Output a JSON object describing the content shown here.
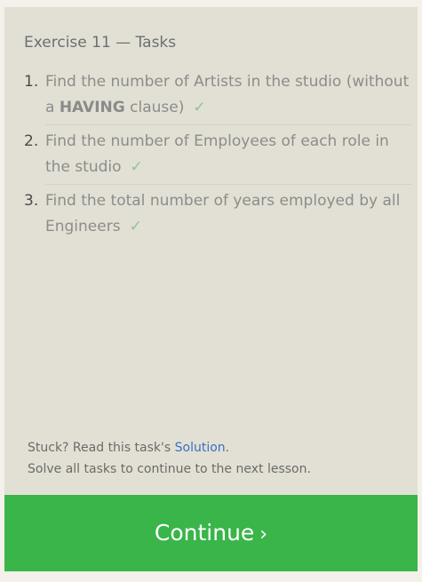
{
  "panel": {
    "title": "Exercise 11 — Tasks"
  },
  "tasks": [
    {
      "number": "1.",
      "text_before": "Find the number of Artists in the studio (without a ",
      "strong": "HAVING",
      "text_after": " clause)",
      "check": "✓"
    },
    {
      "number": "2.",
      "text_before": "Find the number of Employees of each role in the studio",
      "check": "✓"
    },
    {
      "number": "3.",
      "text_before": "Find the total number of years employed by all Engineers",
      "check": "✓"
    }
  ],
  "footer": {
    "stuck_prefix": "Stuck? Read this task's ",
    "solution_link": "Solution",
    "stuck_suffix": ".",
    "instruction": "Solve all tasks to continue to the next lesson."
  },
  "continue_button": {
    "label": "Continue",
    "chevron": "›"
  },
  "colors": {
    "panel_bg": "#e2e0d4",
    "button_bg": "#39b54a",
    "check": "#8fc493",
    "link": "#3a6fc4"
  },
  "icons": {
    "check": "check-icon",
    "continue": "chevron-right-icon"
  }
}
